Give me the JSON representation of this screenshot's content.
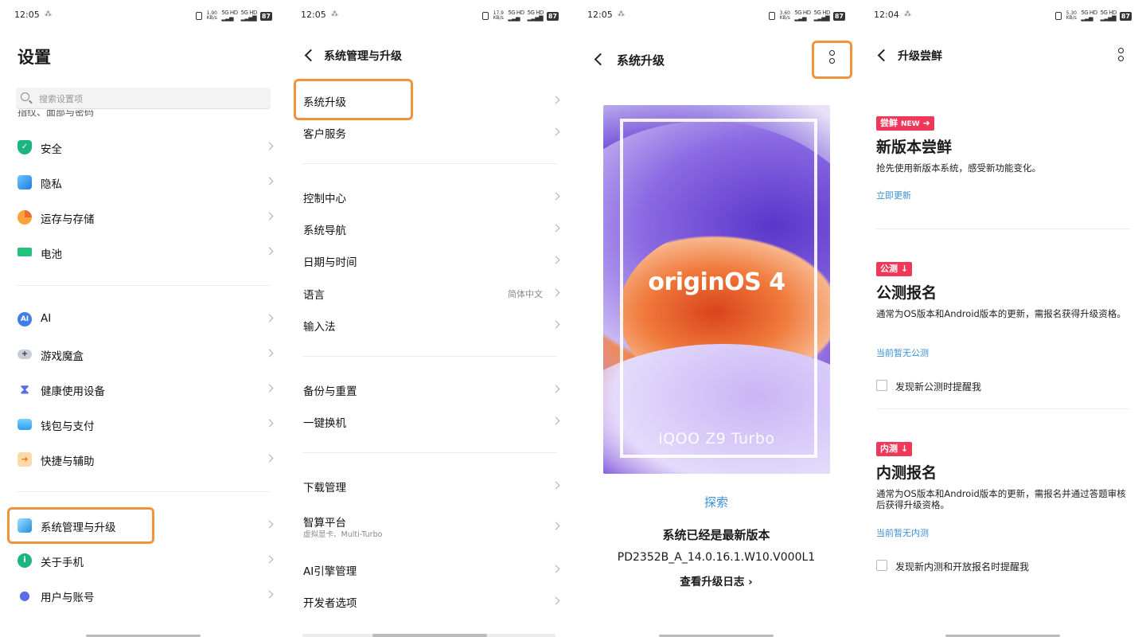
{
  "panel1": {
    "status": {
      "time": "12:05",
      "net_speed": "1.90 KB/s",
      "battery": "87"
    },
    "title": "设置",
    "search_placeholder": "搜索设置项",
    "cut_item": "指纹、面部与密码",
    "group1": [
      {
        "label": "安全",
        "icon": "shield-icon",
        "color": "#1db57f"
      },
      {
        "label": "隐私",
        "icon": "privacy-cube-icon",
        "color": "#3a9df0"
      },
      {
        "label": "运存与存储",
        "icon": "pie-chart-icon",
        "color": "#f7a23b"
      },
      {
        "label": "电池",
        "icon": "battery-icon",
        "color": "#21c27a"
      }
    ],
    "group2": [
      {
        "label": "AI",
        "icon": "ai-icon",
        "color": "#3f7ee8",
        "glyph": "AI"
      },
      {
        "label": "游戏魔盒",
        "icon": "gamepad-icon",
        "color": "#9aa3b0"
      },
      {
        "label": "健康使用设备",
        "icon": "hourglass-icon",
        "color": "#5b6ee8"
      },
      {
        "label": "钱包与支付",
        "icon": "wallet-icon",
        "color": "#2f9ff0"
      },
      {
        "label": "快捷与辅助",
        "icon": "shortcut-icon",
        "color": "#f7a23b"
      }
    ],
    "group3": [
      {
        "label": "系统管理与升级",
        "icon": "system-cube-icon",
        "color": "#3aa7f0"
      },
      {
        "label": "关于手机",
        "icon": "info-icon",
        "color": "#1db57f",
        "glyph": "i"
      },
      {
        "label": "用户与账号",
        "icon": "user-icon",
        "color": "#5b6ee8"
      }
    ]
  },
  "panel2": {
    "status": {
      "time": "12:05",
      "net_speed": "17.9 KB/s",
      "battery": "87"
    },
    "title": "系统管理与升级",
    "group1": [
      {
        "label": "系统升级"
      },
      {
        "label": "客户服务"
      }
    ],
    "group2": [
      {
        "label": "控制中心"
      },
      {
        "label": "系统导航"
      },
      {
        "label": "日期与时间"
      },
      {
        "label": "语言",
        "value": "简体中文"
      },
      {
        "label": "输入法"
      }
    ],
    "group3": [
      {
        "label": "备份与重置"
      },
      {
        "label": "一键换机"
      }
    ],
    "group4": [
      {
        "label": "下载管理"
      },
      {
        "label": "智算平台",
        "sub": "虚拟显卡、Multi-Turbo"
      },
      {
        "label": "AI引擎管理"
      },
      {
        "label": "开发者选项"
      }
    ]
  },
  "panel3": {
    "status": {
      "time": "12:05",
      "net_speed": "3.60 KB/s",
      "battery": "87"
    },
    "title": "系统升级",
    "poster_logo": "originOS 4",
    "poster_model": "iQOO Z9 Turbo",
    "explore": "探索",
    "latest": "系统已经是最新版本",
    "version": "PD2352B_A_14.0.16.1.W10.V000L1",
    "changelog": "查看升级日志"
  },
  "panel4": {
    "status": {
      "time": "12:04",
      "net_speed": "5.30 KB/s",
      "battery": "87"
    },
    "title": "升级尝鲜",
    "sections": [
      {
        "tag": "尝鲜",
        "tag_new": "NEW",
        "title": "新版本尝鲜",
        "desc": "抢先使用新版本系统，感受新功能变化。",
        "link": "立即更新"
      },
      {
        "tag": "公测",
        "title": "公测报名",
        "desc": "通常为OS版本和Android版本的更新，需报名获得升级资格。",
        "link": "当前暂无公测",
        "check": "发现新公测时提醒我"
      },
      {
        "tag": "内测",
        "title": "内测报名",
        "desc": "通常为OS版本和Android版本的更新，需报名并通过答题审核后获得升级资格。",
        "link": "当前暂无内测",
        "check": "发现新内测和开放报名时提醒我"
      }
    ]
  },
  "colors": {
    "highlight": "#f0933c",
    "link": "#3a8fd6",
    "tag": "#f0395a"
  }
}
